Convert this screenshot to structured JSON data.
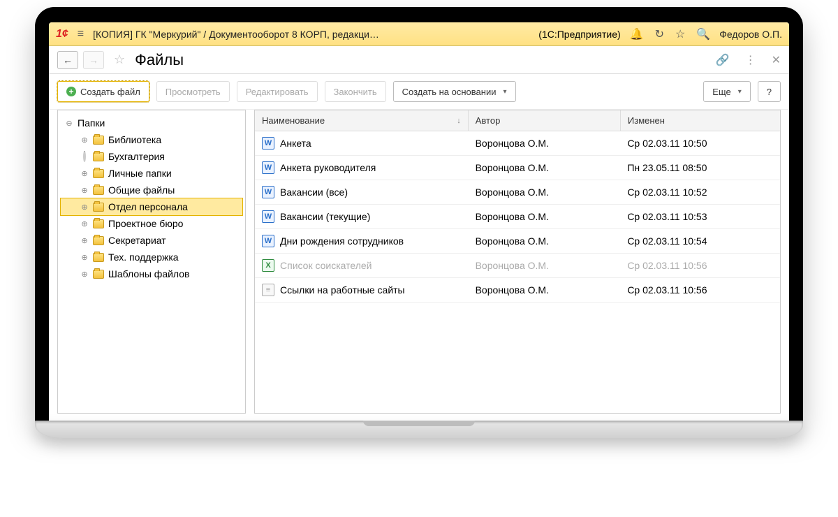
{
  "titlebar": {
    "app_title": "[КОПИЯ] ГК \"Меркурий\" / Документооборот 8 КОРП, редакци…",
    "product": "(1С:Предприятие)",
    "user": "Федоров О.П."
  },
  "page": {
    "title": "Файлы"
  },
  "toolbar": {
    "create_file": "Создать файл",
    "view": "Просмотреть",
    "edit": "Редактировать",
    "finish": "Закончить",
    "create_based_on": "Создать на основании",
    "more": "Еще",
    "help": "?"
  },
  "tree": {
    "root_label": "Папки",
    "items": [
      {
        "label": "Библиотека",
        "state": "collapsed"
      },
      {
        "label": "Бухгалтерия",
        "state": "loading"
      },
      {
        "label": "Личные папки",
        "state": "collapsed"
      },
      {
        "label": "Общие файлы",
        "state": "collapsed"
      },
      {
        "label": "Отдел персонала",
        "state": "collapsed",
        "selected": true
      },
      {
        "label": "Проектное бюро",
        "state": "collapsed"
      },
      {
        "label": "Секретариат",
        "state": "collapsed"
      },
      {
        "label": "Тех. поддержка",
        "state": "collapsed"
      },
      {
        "label": "Шаблоны файлов",
        "state": "collapsed"
      }
    ]
  },
  "table": {
    "columns": {
      "name": "Наименование",
      "author": "Автор",
      "modified": "Изменен"
    },
    "rows": [
      {
        "icon": "word",
        "name": "Анкета",
        "author": "Воронцова О.М.",
        "modified": "Ср 02.03.11 10:50"
      },
      {
        "icon": "word",
        "name": "Анкета руководителя",
        "author": "Воронцова О.М.",
        "modified": "Пн 23.05.11 08:50"
      },
      {
        "icon": "word",
        "name": "Вакансии (все)",
        "author": "Воронцова О.М.",
        "modified": "Ср 02.03.11 10:52"
      },
      {
        "icon": "word",
        "name": "Вакансии (текущие)",
        "author": "Воронцова О.М.",
        "modified": "Ср 02.03.11 10:53"
      },
      {
        "icon": "word",
        "name": "Дни рождения сотрудников",
        "author": "Воронцова О.М.",
        "modified": "Ср 02.03.11 10:54"
      },
      {
        "icon": "excel",
        "name": "Список соискателей",
        "author": "Воронцова О.М.",
        "modified": "Ср 02.03.11 10:56",
        "dim": true
      },
      {
        "icon": "txt",
        "name": "Ссылки на работные сайты",
        "author": "Воронцова О.М.",
        "modified": "Ср 02.03.11 10:56"
      }
    ]
  }
}
